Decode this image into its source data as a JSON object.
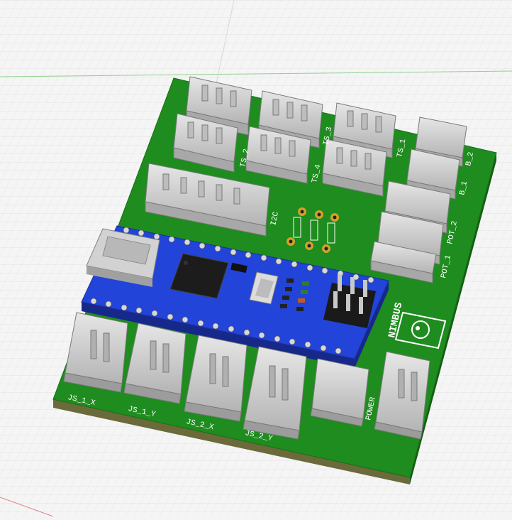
{
  "viewport": {
    "title": "",
    "background": "#f4f4f4",
    "grid_color": "#d6d6d6",
    "axis_x_color": "#7fcf7f",
    "axis_y_color": "#e07a7a"
  },
  "board": {
    "pcb_color": "#1f8a1f",
    "pcb_edge_color": "#145c14",
    "silkscreen_color": "#ffffff",
    "connector_color": "#c9c9c9",
    "arduino_color": "#1f3fd0",
    "logo_text": "NIMBUS",
    "labels": {
      "js1x": "JS_1_X",
      "js1y": "JS_1_Y",
      "js2x": "JS_2_X",
      "js2y": "JS_2_Y",
      "power": "POWER",
      "pot1": "POT_1",
      "pot2": "POT_2",
      "b1": "B_1",
      "b2": "B_2",
      "i2c": "I2C",
      "ts1": "TS_1",
      "ts2": "TS_2",
      "ts3": "TS_3",
      "ts4": "TS_4"
    }
  }
}
